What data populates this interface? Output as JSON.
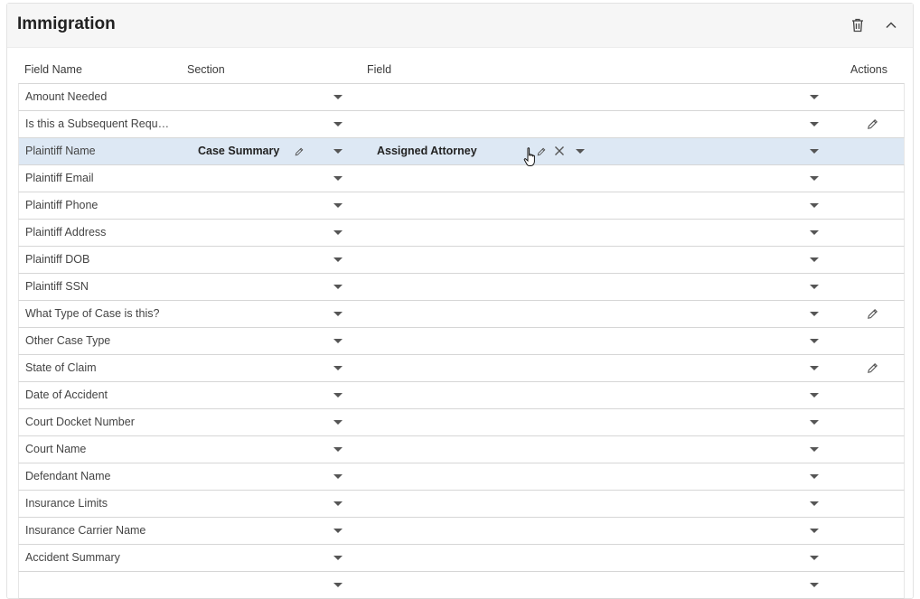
{
  "panel": {
    "title": "Immigration",
    "icons": {
      "delete": "trash-icon",
      "collapse": "chevron-up-icon"
    }
  },
  "table": {
    "columns": [
      "Field Name",
      "Section",
      "Field",
      "Actions"
    ],
    "rows": [
      {
        "name": "Amount Needed",
        "section": "",
        "field": "",
        "editable": false
      },
      {
        "name": "Is this a Subsequent Requ…",
        "section": "",
        "field": "",
        "editable": true
      },
      {
        "name": "Plaintiff Name",
        "section": "Case Summary",
        "field": "Assigned Attorney",
        "editable": false,
        "selected": true
      },
      {
        "name": "Plaintiff Email",
        "section": "",
        "field": "",
        "editable": false
      },
      {
        "name": "Plaintiff Phone",
        "section": "",
        "field": "",
        "editable": false
      },
      {
        "name": "Plaintiff Address",
        "section": "",
        "field": "",
        "editable": false
      },
      {
        "name": "Plaintiff DOB",
        "section": "",
        "field": "",
        "editable": false
      },
      {
        "name": "Plaintiff SSN",
        "section": "",
        "field": "",
        "editable": false
      },
      {
        "name": "What Type of Case is this?",
        "section": "",
        "field": "",
        "editable": true
      },
      {
        "name": "Other Case Type",
        "section": "",
        "field": "",
        "editable": false
      },
      {
        "name": "State of Claim",
        "section": "",
        "field": "",
        "editable": true
      },
      {
        "name": "Date of Accident",
        "section": "",
        "field": "",
        "editable": false
      },
      {
        "name": "Court Docket Number",
        "section": "",
        "field": "",
        "editable": false
      },
      {
        "name": "Court Name",
        "section": "",
        "field": "",
        "editable": false
      },
      {
        "name": "Defendant Name",
        "section": "",
        "field": "",
        "editable": false
      },
      {
        "name": "Insurance Limits",
        "section": "",
        "field": "",
        "editable": false
      },
      {
        "name": "Insurance Carrier Name",
        "section": "",
        "field": "",
        "editable": false
      },
      {
        "name": "Accident Summary",
        "section": "",
        "field": "",
        "editable": false
      },
      {
        "name": "",
        "section": "",
        "field": "",
        "editable": false
      }
    ]
  },
  "colors": {
    "selected_row": "#dde8f4",
    "border": "#d6d6d6"
  }
}
